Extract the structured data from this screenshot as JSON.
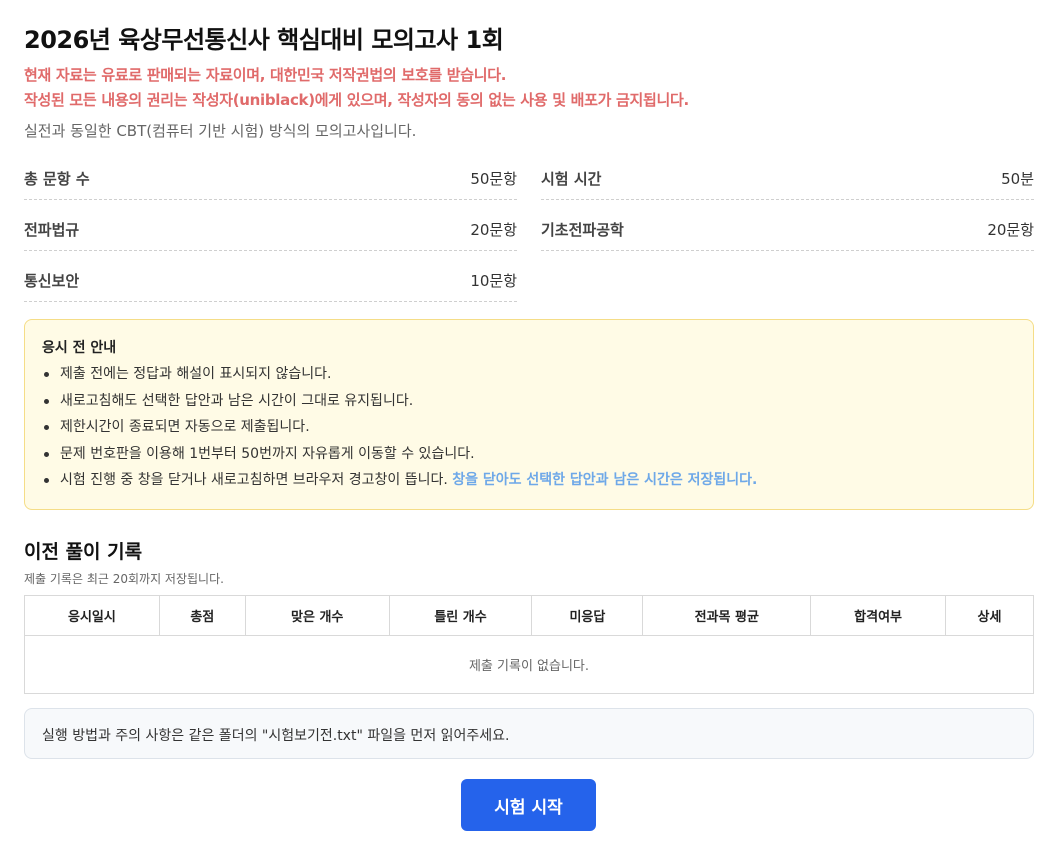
{
  "page": {
    "title": "2026년 육상무선통신사 핵심대비 모의고사 1회",
    "warning_line1": "현재 자료는 유료로 판매되는 자료이며, 대한민국 저작권법의 보호를 받습니다.",
    "warning_line2": "작성된 모든 내용의 권리는 작성자(uniblack)에게 있으며, 작성자의 동의 없는 사용 및 배포가 금지됩니다.",
    "subtitle": "실전과 동일한 CBT(컴퓨터 기반 시험) 방식의 모의고사입니다."
  },
  "stats": {
    "total_label": "총 문항 수",
    "total_value": "50문항",
    "time_label": "시험 시간",
    "time_value": "50분",
    "subj1_label": "전파법규",
    "subj1_value": "20문항",
    "subj2_label": "기초전파공학",
    "subj2_value": "20문항",
    "subj3_label": "통신보안",
    "subj3_value": "10문항"
  },
  "notice": {
    "title": "응시 전 안내",
    "items": [
      "제출 전에는 정답과 해설이 표시되지 않습니다.",
      "새로고침해도 선택한 답안과 남은 시간이 그대로 유지됩니다.",
      "제한시간이 종료되면 자동으로 제출됩니다.",
      "문제 번호판을 이용해 1번부터 50번까지 자유롭게 이동할 수 있습니다.",
      "시험 진행 중 창을 닫거나 새로고침하면 브라우저 경고창이 뜹니다."
    ],
    "highlight": "창을 닫아도 선택한 답안과 남은 시간은 저장됩니다."
  },
  "history": {
    "title": "이전 풀이 기록",
    "subtitle": "제출 기록은 최근 20회까지 저장됩니다.",
    "columns": [
      "응시일시",
      "총점",
      "맞은 개수",
      "틀린 개수",
      "미응답",
      "전과목 평균",
      "합격여부",
      "상세"
    ],
    "empty_message": "제출 기록이 없습니다."
  },
  "info": {
    "text": "실행 방법과 주의 사항은 같은 폴더의 \"시험보기전.txt\" 파일을 먼저 읽어주세요."
  },
  "start_button": {
    "label": "시험 시작"
  },
  "colors": {
    "warning": "#e06a6a",
    "highlight": "#6ea8e8",
    "primary": "#2563eb",
    "notice_bg": "#fffbe6"
  }
}
